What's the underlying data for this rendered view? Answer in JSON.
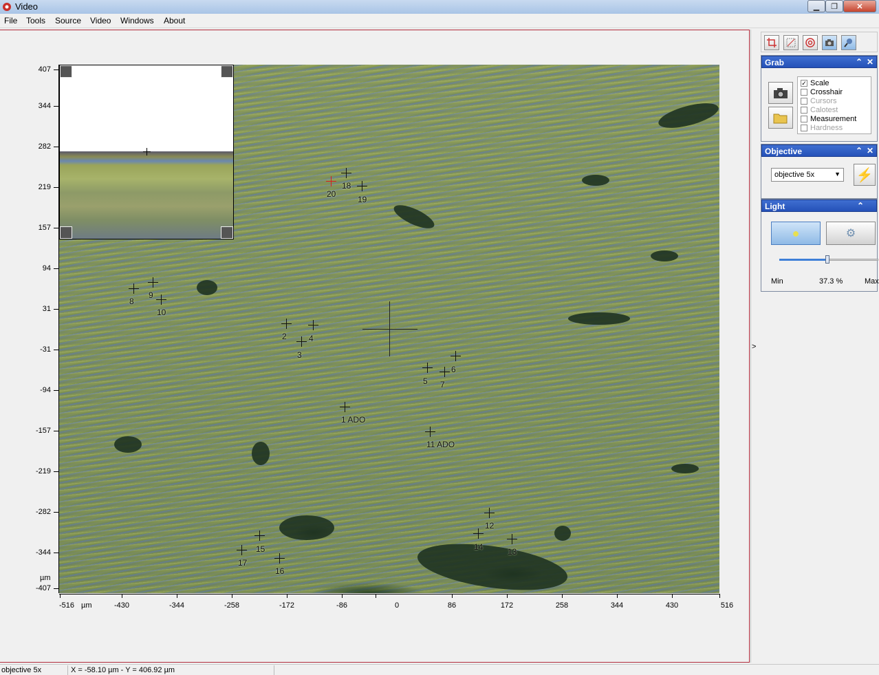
{
  "window": {
    "title": "Video"
  },
  "menu": [
    "File",
    "Tools",
    "Source",
    "Video",
    "Windows",
    "About"
  ],
  "y_axis": {
    "unit": "µm",
    "ticks": [
      "407",
      "344",
      "282",
      "219",
      "157",
      "94",
      "31",
      "-31",
      "-94",
      "-157",
      "-219",
      "-282",
      "-344",
      "-407"
    ]
  },
  "x_axis": {
    "unit": "µm",
    "ticks": [
      "-516",
      "-430",
      "-344",
      "-258",
      "-172",
      "-86",
      "0",
      "86",
      "172",
      "258",
      "344",
      "430",
      "516"
    ]
  },
  "markers": [
    {
      "label": "1 ADO",
      "color": "black"
    },
    {
      "label": "2",
      "color": "black"
    },
    {
      "label": "3",
      "color": "black"
    },
    {
      "label": "4",
      "color": "black"
    },
    {
      "label": "5",
      "color": "black"
    },
    {
      "label": "6",
      "color": "black"
    },
    {
      "label": "7",
      "color": "black"
    },
    {
      "label": "8",
      "color": "black"
    },
    {
      "label": "9",
      "color": "black"
    },
    {
      "label": "10",
      "color": "black"
    },
    {
      "label": "11 ADO",
      "color": "black"
    },
    {
      "label": "12",
      "color": "black"
    },
    {
      "label": "13",
      "color": "black"
    },
    {
      "label": "14",
      "color": "black"
    },
    {
      "label": "15",
      "color": "black"
    },
    {
      "label": "16",
      "color": "black"
    },
    {
      "label": "17",
      "color": "black"
    },
    {
      "label": "18",
      "color": "black"
    },
    {
      "label": "19",
      "color": "black"
    },
    {
      "label": "20",
      "color": "#d62020"
    }
  ],
  "toolbar": {
    "icons": [
      "crop-icon",
      "select-icon",
      "target-icon",
      "camera-icon",
      "probe-icon"
    ]
  },
  "grab": {
    "title": "Grab",
    "options": [
      {
        "label": "Scale",
        "checked": true,
        "enabled": true
      },
      {
        "label": "Crosshair",
        "checked": false,
        "enabled": true
      },
      {
        "label": "Cursors",
        "checked": false,
        "enabled": false
      },
      {
        "label": "Calotest",
        "checked": false,
        "enabled": false
      },
      {
        "label": "Measurement",
        "checked": false,
        "enabled": true
      },
      {
        "label": "Hardness",
        "checked": false,
        "enabled": false
      }
    ]
  },
  "objective": {
    "title": "Objective",
    "selected": "objective 5x"
  },
  "light": {
    "title": "Light",
    "min_label": "Min",
    "max_label": "Max",
    "value_label": "37.3 %",
    "level_fraction": 0.373
  },
  "status": {
    "objective": "objective 5x",
    "coords": "X = -58.10 µm - Y = 406.92 µm"
  },
  "splitter_label": ">"
}
